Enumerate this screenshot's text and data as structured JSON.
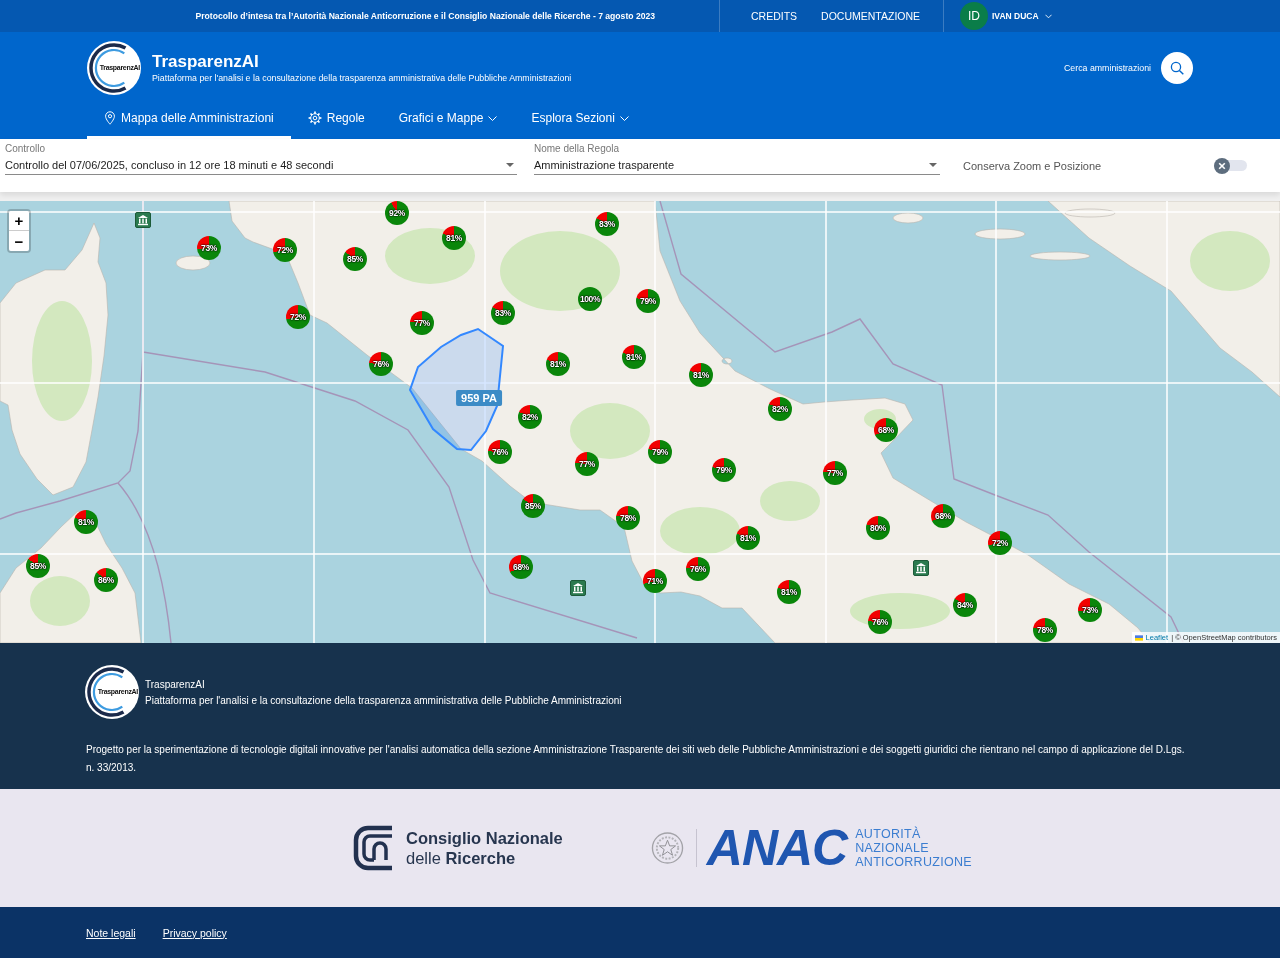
{
  "top_bar": {
    "notice": "Protocollo d’intesa tra l’Autorità Nazionale Anticorruzione e il Consiglio Nazionale delle Ricerche - 7 agosto 2023",
    "links": [
      "CREDITS",
      "DOCUMENTAZIONE"
    ],
    "user": {
      "initials": "ID",
      "name": "IVAN DUCA"
    }
  },
  "header": {
    "logo_text": "TrasparenzAI",
    "title": "TrasparenzAI",
    "subtitle": "Piattaforma per l'analisi e la consultazione della trasparenza amministrativa delle Pubbliche Amministrazioni",
    "search_label": "Cerca amministrazioni"
  },
  "nav": [
    {
      "label": "Mappa delle Amministrazioni",
      "selected": true,
      "dropdown": false
    },
    {
      "label": "Regole",
      "selected": false,
      "dropdown": false
    },
    {
      "label": "Grafici e Mappe",
      "selected": false,
      "dropdown": true
    },
    {
      "label": "Esplora Sezioni",
      "selected": false,
      "dropdown": true
    }
  ],
  "filters": {
    "fields": [
      {
        "label": "Controllo",
        "value": "Controllo del 07/06/2025, concluso in 12 ore 18 minuti e 48 secondi"
      },
      {
        "label": "Nome della Regola",
        "value": "Amministrazione trasparente"
      }
    ],
    "toggle": {
      "label": "Conserva Zoom e Posizione",
      "on": false
    }
  },
  "map": {
    "zoom_buttons": [
      "+",
      "−"
    ],
    "markers": [
      {
        "label": "92%"
      },
      {
        "label": "83%"
      },
      {
        "label": "81%"
      },
      {
        "label": "73%"
      },
      {
        "label": "72%"
      },
      {
        "label": "85%"
      },
      {
        "label": "100%"
      },
      {
        "label": "79%"
      },
      {
        "label": "83%"
      },
      {
        "label": "72%"
      },
      {
        "label": "77%"
      },
      {
        "label": "81%"
      },
      {
        "label": "76%"
      },
      {
        "label": "81%"
      },
      {
        "label": "81%"
      },
      {
        "label": "82%"
      },
      {
        "label": "82%"
      },
      {
        "label": "68%"
      },
      {
        "label": "76%"
      },
      {
        "label": "79%"
      },
      {
        "label": "77%"
      },
      {
        "label": "79%"
      },
      {
        "label": "77%"
      },
      {
        "label": "85%"
      },
      {
        "label": "68%"
      },
      {
        "label": "78%"
      },
      {
        "label": "81%"
      },
      {
        "label": "80%"
      },
      {
        "label": "81%"
      },
      {
        "label": "72%"
      },
      {
        "label": "85%"
      },
      {
        "label": "68%"
      },
      {
        "label": "76%"
      },
      {
        "label": "86%"
      },
      {
        "label": "71%"
      },
      {
        "label": "81%"
      },
      {
        "label": "84%"
      },
      {
        "label": "73%"
      },
      {
        "label": "76%"
      },
      {
        "label": "78%"
      }
    ],
    "tooltip": "959 PA",
    "attribution": {
      "link": "Leaflet",
      "text": "| © OpenStreetMap contributors"
    }
  },
  "footer": {
    "logo_text": "TrasparenzAI",
    "title": "TrasparenzAI",
    "subtitle": "Piattaforma per l'analisi e la consultazione della trasparenza amministrativa delle Pubbliche Amministrazioni",
    "description": "Progetto per la sperimentazione di tecnologie digitali innovative per l'analisi automatica della sezione Amministrazione Trasparente dei siti web delle Pubbliche Amministrazioni e dei soggetti giuridici che rientrano nel campo di applicazione del D.Lgs. n. 33/2013."
  },
  "partners": {
    "cnr": [
      "Consiglio Nazionale",
      "delle **Ricerche**"
    ],
    "anac": {
      "wordmark": "ANAC",
      "lines": [
        "AUTORITÀ",
        "NAZIONALE",
        "ANTICORRUZIONE"
      ]
    }
  },
  "legal_links": [
    "Note legali",
    "Privacy policy"
  ]
}
